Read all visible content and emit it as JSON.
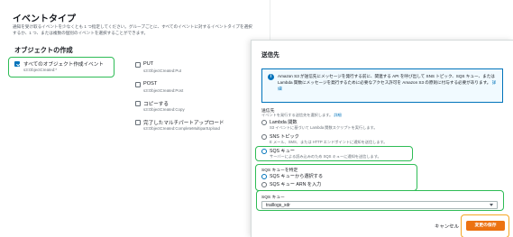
{
  "event_types": {
    "title": "イベントタイプ",
    "description": "通知を受け取るイベントを少なくとも 1 つ指定してください。グループごとに、すべてのイベントに対するイベントタイプを選択するか、1 つ、または複数の個別のイベントを選択することができます。",
    "group_title": "オブジェクトの作成",
    "options": [
      {
        "label": "すべてのオブジェクト作成イベント",
        "sub": "s3:ObjectCreated:*",
        "checked": true
      },
      {
        "label": "PUT",
        "sub": "s3:ObjectCreated:Put",
        "checked": false
      },
      {
        "label": "POST",
        "sub": "s3:ObjectCreated:Post",
        "checked": false
      },
      {
        "label": "コピーする",
        "sub": "s3:ObjectCreated:Copy",
        "checked": false
      },
      {
        "label": "完了したマルチパートアップロード",
        "sub": "s3:ObjectCreated:CompleteMultipartUpload",
        "checked": false
      }
    ]
  },
  "destination": {
    "title": "送信先",
    "info": {
      "text": "Amazon S3 が送信先にメッセージを発行する前に、関連する API を呼び出して SNS トピック、SQS キュー、または Lambda 関数にメッセージを発行するために必要なアクセス許可を Amazon S3 の原則に付与する必要があります。",
      "link": "詳細"
    },
    "label": "送信先",
    "desc": "イベントを発行する送信先を選択します。",
    "desc_link": "詳細",
    "options": [
      {
        "label": "Lambda 関数",
        "sub": "S3 イベントに基づいて Lambda 関数スクリプトを実行します。",
        "selected": false
      },
      {
        "label": "SNS トピック",
        "sub": "E メール、SMS、または HTTP エンドポイントに通知を送信します。",
        "selected": false
      },
      {
        "label": "SQS キュー",
        "sub": "サーバーによる読み込みのため SQS キューに通知を送信します。",
        "selected": true
      }
    ],
    "specify": {
      "label": "SQS キューを特定",
      "options": [
        {
          "label": "SQS キューから選択する",
          "selected": true
        },
        {
          "label": "SQS キュー ARN を入力",
          "selected": false
        }
      ]
    },
    "queue": {
      "label": "SQS キュー",
      "value": "traillogs_xdr"
    },
    "cancel_label": "キャンセル",
    "save_label": "変更の保存"
  },
  "colors": {
    "highlight": "#2ebc55",
    "save_highlight": "#f5a623",
    "primary_button": "#ec7211",
    "link": "#0073bb"
  }
}
